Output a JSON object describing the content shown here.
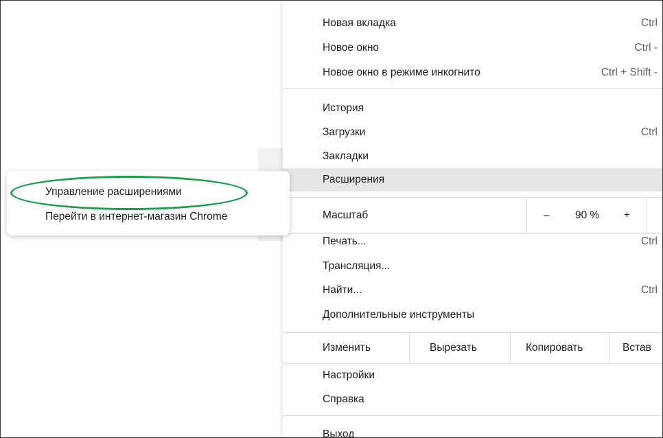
{
  "colors": {
    "highlight": "#e6e6e6",
    "oval": "#1aa14a",
    "separator": "#dadce0"
  },
  "menu": {
    "group1": [
      {
        "label": "Новая вкладка",
        "shortcut": "Ctrl"
      },
      {
        "label": "Новое окно",
        "shortcut": "Ctrl -"
      },
      {
        "label": "Новое окно в режиме инкогнито",
        "shortcut": "Ctrl + Shift -"
      }
    ],
    "group2": [
      {
        "label": "История",
        "shortcut": ""
      },
      {
        "label": "Загрузки",
        "shortcut": "Ctrl"
      },
      {
        "label": "Закладки",
        "shortcut": ""
      },
      {
        "label": "Расширения",
        "shortcut": ""
      }
    ],
    "zoom": {
      "label": "Масштаб",
      "minus": "–",
      "value": "90 %",
      "plus": "+"
    },
    "group3": [
      {
        "label": "Печать...",
        "shortcut": "Ctrl"
      },
      {
        "label": "Трансляция...",
        "shortcut": ""
      },
      {
        "label": "Найти...",
        "shortcut": "Ctrl"
      },
      {
        "label": "Дополнительные инструменты",
        "shortcut": ""
      }
    ],
    "edit": {
      "label": "Изменить",
      "cut": "Вырезать",
      "copy": "Копировать",
      "paste": "Встав"
    },
    "group4": [
      {
        "label": "Настройки"
      },
      {
        "label": "Справка"
      }
    ],
    "exit": "Выход"
  },
  "submenu": {
    "items": [
      "Управление расширениями",
      "Перейти в интернет-магазин Chrome"
    ]
  }
}
